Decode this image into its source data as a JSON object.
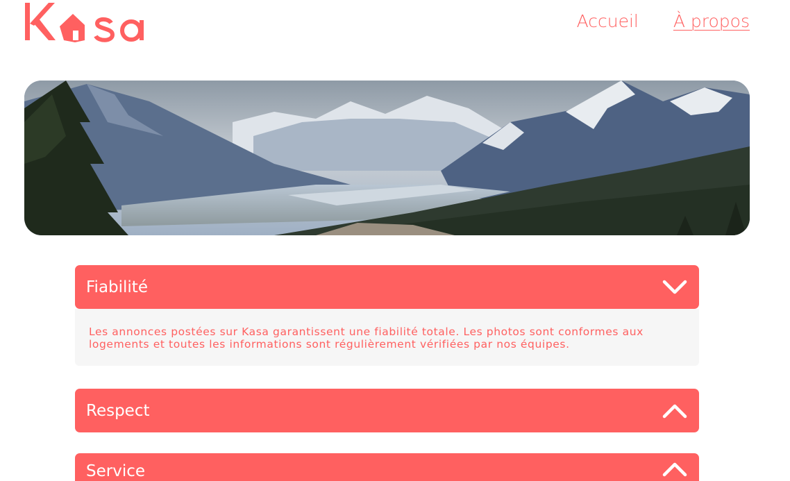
{
  "header": {
    "logo_text": "Kasa",
    "nav": [
      {
        "label": "Accueil",
        "active": false
      },
      {
        "label": "À propos",
        "active": true
      }
    ]
  },
  "banner": {
    "image": "mountain-valley-landscape"
  },
  "collapses": [
    {
      "title": "Fiabilité",
      "open": true,
      "icon": "chevron-down-icon",
      "content": "Les annonces postées sur Kasa garantissent une fiabilité totale. Les photos sont conformes aux logements et toutes les informations sont régulièrement vérifiées par nos équipes."
    },
    {
      "title": "Respect",
      "open": false,
      "icon": "chevron-up-icon"
    },
    {
      "title": "Service",
      "open": false,
      "icon": "chevron-up-icon"
    }
  ],
  "colors": {
    "primary": "#ff6060",
    "body_bg": "#f6f6f6"
  }
}
